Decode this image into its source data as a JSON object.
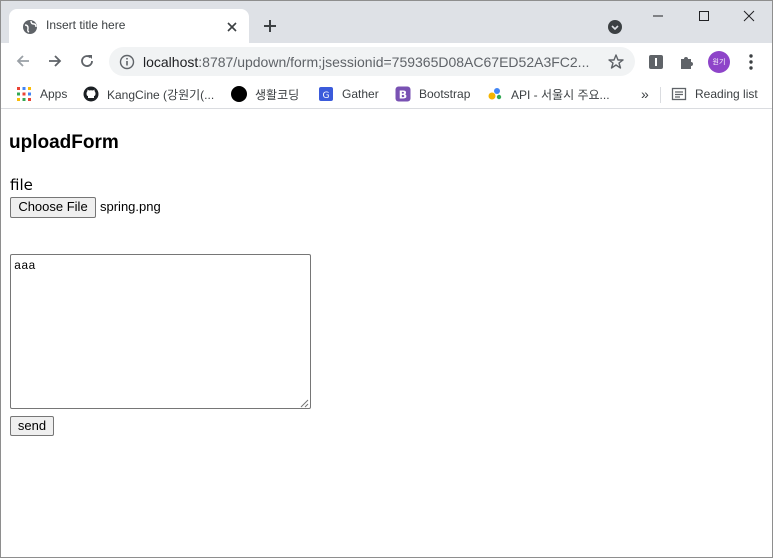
{
  "browser": {
    "tab": {
      "title": "Insert title here",
      "favicon": "globe-icon"
    },
    "url": {
      "host": "localhost",
      "rest": ":8787/updown/form;jsessionid=759365D08AC67ED52A3FC2..."
    },
    "profile_label": "원기",
    "bookmarks": [
      {
        "label": "Apps",
        "icon": "apps-grid-icon"
      },
      {
        "label": "KangCine (강원기(...",
        "icon": "github-icon"
      },
      {
        "label": "생활코딩",
        "icon": "black-circle-icon"
      },
      {
        "label": "Gather",
        "icon": "gather-icon"
      },
      {
        "label": "Bootstrap",
        "icon": "bootstrap-icon"
      },
      {
        "label": "API - 서울시 주요...",
        "icon": "api-icon"
      }
    ],
    "overflow_label": "»",
    "reading_list_label": "Reading list"
  },
  "page": {
    "title": "uploadForm",
    "file_label": "file",
    "choose_button": "Choose File",
    "file_name": "spring.png",
    "textarea_value": "aaa",
    "send_button": "send"
  },
  "colors": {
    "tabstrip_bg": "#dee1e6",
    "omnibox_bg": "#f1f3f4",
    "profile_bg": "#8e44c9",
    "button_bg": "#efefef"
  }
}
